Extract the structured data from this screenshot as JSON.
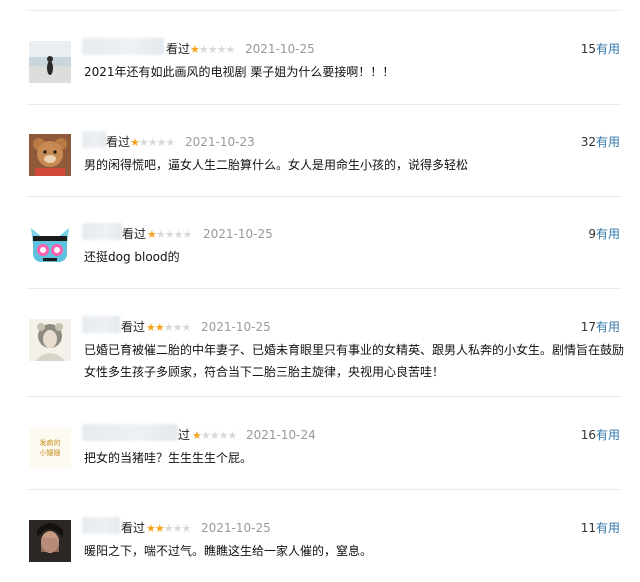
{
  "comments": [
    {
      "status": "看过",
      "rating": 1,
      "date": "2021-10-25",
      "votes": "15",
      "useful_label": "有用",
      "text": "2021年还有如此画风的电视剧 栗子姐为什么要接啊！！！",
      "avatar": "beach-photo"
    },
    {
      "status": "看过",
      "rating": 1,
      "date": "2021-10-23",
      "votes": "32",
      "useful_label": "有用",
      "text": "男的闲得慌吧，逼女人生二胎算什么。女人是用命生小孩的，说得多轻松",
      "avatar": "teddy-bear"
    },
    {
      "status": "看过",
      "rating": 1,
      "date": "2021-10-25",
      "votes": "9",
      "useful_label": "有用",
      "text": "还挺dog blood的",
      "avatar": "cartoon-cat"
    },
    {
      "status": "看过",
      "rating": 2,
      "date": "2021-10-25",
      "votes": "17",
      "useful_label": "有用",
      "text": "已婚已育被催二胎的中年妻子、已婚未育眼里只有事业的女精英、跟男人私奔的小女生。剧情旨在鼓励女性多生孩子多顾家，符合当下二胎三胎主旋律，央视用心良苦哇！",
      "avatar": "girl-portrait"
    },
    {
      "status": "过",
      "rating": 1,
      "date": "2021-10-24",
      "votes": "16",
      "useful_label": "有用",
      "text": "把女的当猪哇？生生生生个屁。",
      "avatar": "calligraphy",
      "avatar_text": "发疯的小嫂嫂"
    },
    {
      "status": "看过",
      "rating": 2,
      "date": "2021-10-25",
      "votes": "11",
      "useful_label": "有用",
      "text": "暖阳之下，喘不过气。瞧瞧这生给一家人催的，窒息。",
      "avatar": "dark-portrait"
    }
  ],
  "colors": {
    "star": "#f7a41e",
    "link": "#3377aa",
    "date": "#999999",
    "separator": "#ececec"
  }
}
